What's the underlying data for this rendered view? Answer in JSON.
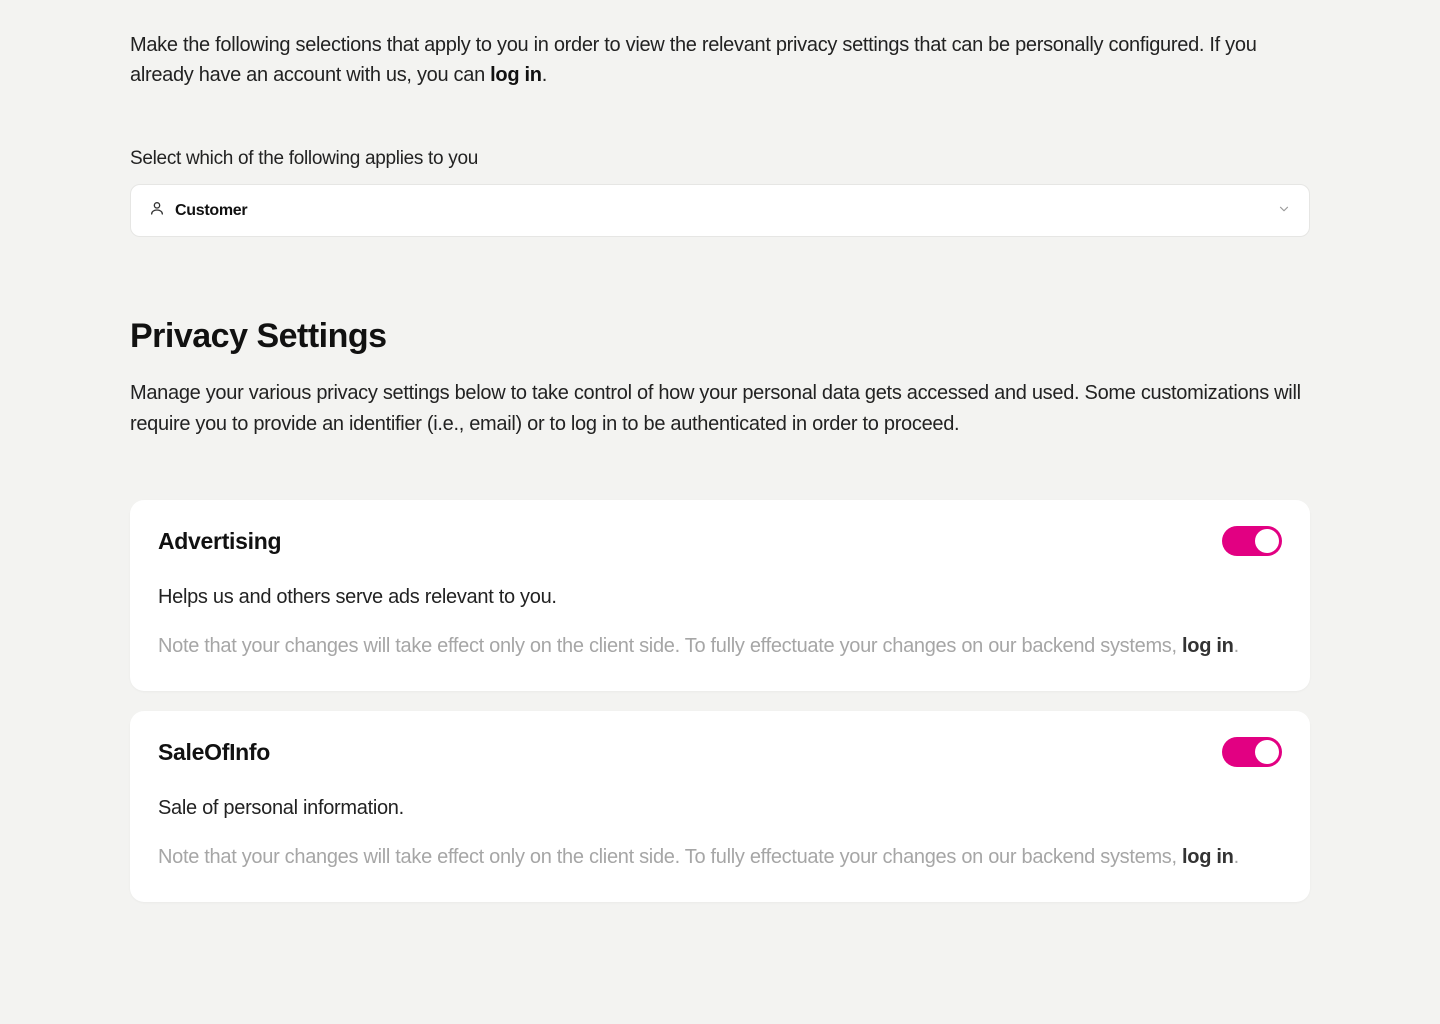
{
  "intro": {
    "text_before": "Make the following selections that apply to you in order to view the relevant privacy settings that can be personally configured. If you already have an account with us, you can ",
    "login_label": "log in",
    "text_after": "."
  },
  "selector": {
    "label": "Select which of the following applies to you",
    "value": "Customer"
  },
  "section": {
    "title": "Privacy Settings",
    "description": "Manage your various privacy settings below to take control of how your personal data gets accessed and used. Some customizations will require you to provide an identifier (i.e., email) or to log in to be authenticated in order to proceed."
  },
  "cards": [
    {
      "title": "Advertising",
      "subtitle": "Helps us and others serve ads relevant to you.",
      "note_before": "Note that your changes will take effect only on the client side. To fully effectuate your changes on our backend systems, ",
      "login_label": "log in",
      "note_after": ".",
      "toggle_on": true
    },
    {
      "title": "SaleOfInfo",
      "subtitle": "Sale of personal information.",
      "note_before": "Note that your changes will take effect only on the client side. To fully effectuate your changes on our backend systems, ",
      "login_label": "log in",
      "note_after": ".",
      "toggle_on": true
    }
  ],
  "colors": {
    "accent": "#e20082",
    "background": "#f3f3f1"
  }
}
